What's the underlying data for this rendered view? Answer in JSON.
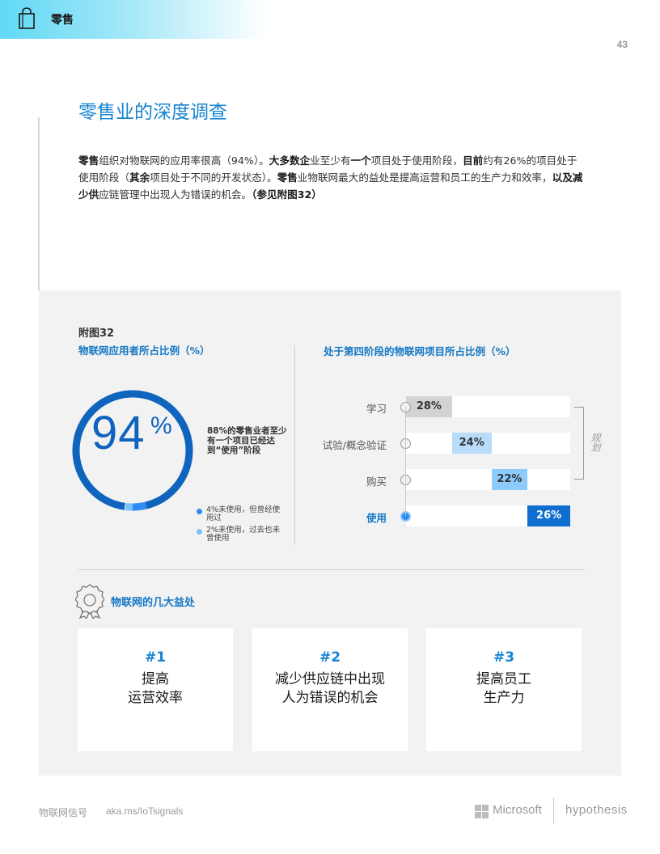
{
  "header": {
    "section": "零售",
    "page_number": "43",
    "icon": "shopping-bag-icon"
  },
  "title": "零售业的深度调查",
  "intro": {
    "p1_b": "零售",
    "p1": "组织对物联网的应用率很高（94%）。",
    "p2_b": "大多数企",
    "p2": "业至少有",
    "p3_b": "一个",
    "p4": "项目处于使用阶段，",
    "p5_b": "目前",
    "p6": "约有26%的项目处于使用阶段（",
    "p7_b": "其余",
    "p8": "项目处于不同的开发状态）。",
    "p9_b": "零售",
    "p10": "业物联网最大的益处是提高运营和员工的生产力和效率，",
    "p11_b": "以及减少供",
    "p12": "应链管理中出现人为错误的机会。",
    "p13_b": "（参见附图32）"
  },
  "figure": {
    "label": "附图32",
    "left_heading": "物联网应用者所占比例（%）",
    "right_heading": "处于第四阶段的物联网项目所占比例（%）",
    "donut": {
      "big_value": "94",
      "percent_sign": "%",
      "note": "88%的零售业者至少有一个项目已经达到“使用”阶段",
      "legend": [
        {
          "text": "4%未使用，但曾经使用过",
          "color": "#2e8df0"
        },
        {
          "text": "2%未使用，过去也未曾使用",
          "color": "#7cc1fa"
        }
      ],
      "colors": {
        "main": "#0f64bd",
        "a": "#2e8df0",
        "b": "#7cc1fa"
      }
    },
    "plan_label": "规划"
  },
  "chart_data": {
    "type": "bar",
    "categories": [
      "学习",
      "试验/概念验证",
      "购买",
      "使用"
    ],
    "values": [
      28,
      24,
      22,
      26
    ],
    "value_labels": [
      "28%",
      "24%",
      "22%",
      "26%"
    ],
    "colors": [
      "#d3d3d3",
      "#b9dcfa",
      "#8ccbfb",
      "#0f6ecf"
    ],
    "bracket_label": "规划",
    "layout": "stacked-progressive"
  },
  "benefits": {
    "heading": "物联网的几大益处",
    "icon": "award-ribbon-icon",
    "cards": [
      {
        "num": "#1",
        "line1": "提高",
        "line2": "运营效率"
      },
      {
        "num": "#2",
        "line1": "减少供应链中出现",
        "line2": "人为错误的机会"
      },
      {
        "num": "#3",
        "line1": "提高员工",
        "line2": "生产力"
      }
    ]
  },
  "footer": {
    "left": "物联网信号",
    "url": "aka.ms/IoTsignals",
    "microsoft": "Microsoft",
    "hypothesis": "hypothesis"
  }
}
